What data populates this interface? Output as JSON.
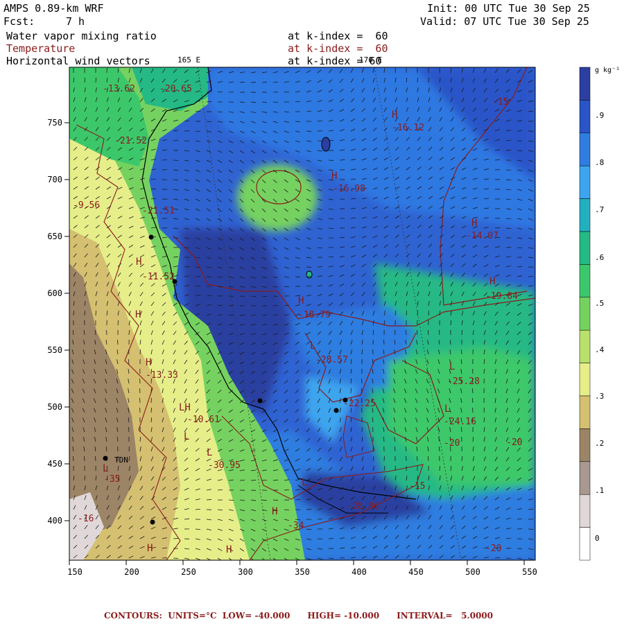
{
  "header": {
    "model": "AMPS 0.89-km WRF",
    "forecast_label": "Fcst:",
    "forecast_hour": "7 h",
    "init": "Init: 00 UTC Tue 30 Sep 25",
    "valid": "Valid: 07 UTC Tue 30 Sep 25"
  },
  "fields": [
    {
      "name": "Water vapor mixing ratio",
      "level": "at k-index =  60",
      "color": "#000000"
    },
    {
      "name": "Temperature",
      "level": "at k-index =  60",
      "color": "#8b1a1a"
    },
    {
      "name": "Horizontal wind vectors",
      "level": "at k-index = 60",
      "color": "#000000"
    }
  ],
  "map": {
    "x_ticks": [
      "150",
      "200",
      "250",
      "300",
      "350",
      "400",
      "450",
      "500",
      "550"
    ],
    "y_ticks": [
      "750",
      "700",
      "650",
      "600",
      "550",
      "500",
      "450",
      "400"
    ],
    "meridian_labels": [
      "165 E",
      "170 E"
    ],
    "temperature_labels": [
      "-13.62",
      "-20.65",
      "-21.52",
      "-9.56",
      "-21.51",
      "-16.12",
      "-16.98",
      "-14.07",
      "-15",
      "-11.52",
      "-19.84",
      "-18.79",
      "-28.57",
      "-13.33",
      "-25.28",
      "-10.61",
      "-22.25",
      "-24.16",
      "-30.95",
      "-35",
      "-15",
      "-28.86",
      "-20",
      "-20",
      "-16",
      "-34",
      "-20"
    ],
    "hl_markers": [
      "H",
      "H",
      "H",
      "H",
      "H",
      "H",
      "H",
      "H",
      "L",
      "L",
      "LH",
      "L",
      "L",
      "L",
      "L",
      "L",
      "H",
      "H",
      "H"
    ],
    "station_label": "TDN"
  },
  "colorbar": {
    "unit": "g kg⁻¹",
    "labels": [
      ".9",
      ".8",
      ".7",
      ".6",
      ".5",
      ".4",
      ".3",
      ".2",
      ".1",
      "0"
    ],
    "colors": [
      "#2c3fa0",
      "#2a55c8",
      "#2f7de0",
      "#3ea4ee",
      "#22b0c0",
      "#25b985",
      "#3cc86a",
      "#76d260",
      "#b8e06a",
      "#e6ee8a",
      "#d4c070",
      "#9c8466",
      "#a89890",
      "#e0d8d8",
      "#ffffff"
    ]
  },
  "footer": "CONTOURS:  UNITS=°C  LOW= -40.000      HIGH= -10.000      INTERVAL=   5.0000"
}
